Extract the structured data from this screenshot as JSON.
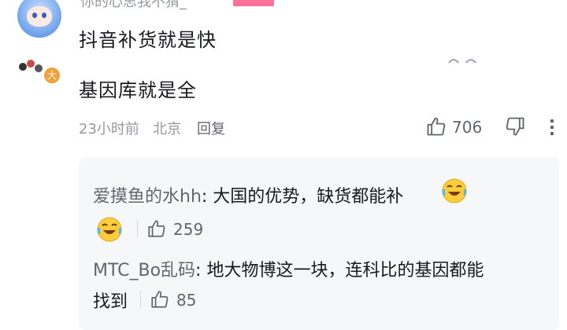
{
  "header": {
    "username": "你的心思我不猜_",
    "comment_text": "抖音补货就是快"
  },
  "main_comment": {
    "text": "基因库就是全",
    "user_level_badge": "大",
    "time": "23小时前",
    "location": "北京",
    "reply_label": "回复",
    "like_count": "706"
  },
  "replies": [
    {
      "name": "爱摸鱼的水hh",
      "text": "大国的优势，缺货都能补",
      "like_count": "259",
      "emoji": "laugh-cry-emoji"
    },
    {
      "name": "MTC_Bo乱码",
      "text_line1": "地大物博这一块，连科比的基因都能",
      "text_line2": "找到",
      "like_count": "85"
    }
  ],
  "colors": {
    "accent_pink": "#fb7299",
    "meta_gray": "#9499a0",
    "reply_bg": "#f6f7f8",
    "level_badge": "#f0a13a"
  }
}
